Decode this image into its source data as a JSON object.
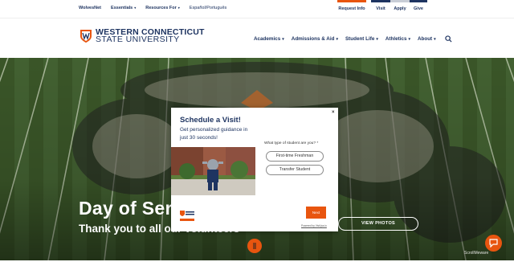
{
  "utility": {
    "links": [
      "WolvesNet",
      "Essentials",
      "Resources For"
    ],
    "language": "Español/Português",
    "right_buttons": [
      {
        "label": "Request Info",
        "color": "#e8550f"
      },
      {
        "label": "Visit",
        "color": "#1e3461"
      },
      {
        "label": "Apply",
        "color": "#c8cdd6"
      },
      {
        "label": "Give",
        "color": "#1e3461"
      }
    ]
  },
  "header": {
    "logo_line1": "WESTERN CONNECTICUT",
    "logo_line2": "STATE UNIVERSITY",
    "nav": [
      "Academics",
      "Admissions & Aid",
      "Student Life",
      "Athletics",
      "About"
    ],
    "search_icon": "search-icon"
  },
  "hero": {
    "title": "Day of Ser",
    "subtitle": "Thank you to all our volunteers",
    "cta": "VIEW PHOTOS"
  },
  "modal": {
    "close": "×",
    "title": "Schedule a Visit!",
    "description": "Get personalized guidance in just 30 seconds!",
    "question": "What type of student are you? *",
    "options": [
      "First-time Freshman",
      "Transfer Student"
    ],
    "next": "Next",
    "powered": "Powered by Visit.jss.io"
  },
  "widgets": {
    "scroll_badge": "ScrollMeware"
  },
  "colors": {
    "navy": "#1e3461",
    "orange": "#e8550f"
  }
}
